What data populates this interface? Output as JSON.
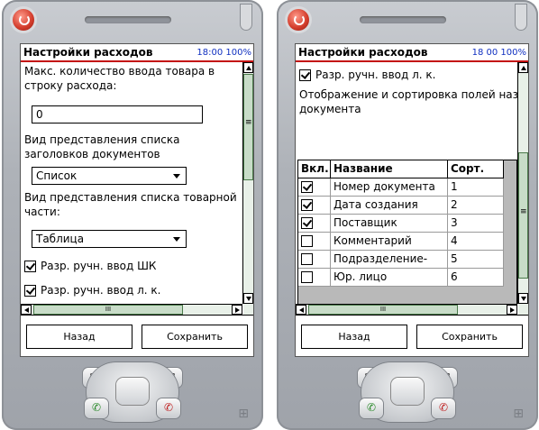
{
  "left_screen": {
    "title": "Настройки расходов",
    "time": "18:00",
    "battery": "100%",
    "max_qty_label": "Макс. количество ввода товара в строку расхода:",
    "max_qty_value": "0",
    "doc_list_view_label": "Вид представления списка заголовков документов",
    "doc_list_view_value": "Список",
    "goods_view_label": "Вид представления списка товарной части:",
    "goods_view_value": "Таблица",
    "manual_barcode_label": "Разр. ручн. ввод ШК",
    "manual_barcode_checked": true,
    "manual_account_label": "Разр. ручн. ввод л. к.",
    "manual_account_checked": true,
    "back_label": "Назад",
    "save_label": "Сохранить"
  },
  "right_screen": {
    "title": "Настройки расходов",
    "time": "18 00",
    "battery": "100%",
    "manual_account_label": "Разр. ручн. ввод л. к.",
    "manual_account_checked": true,
    "fields_label": "Отображение и сортировка полей наз документа",
    "columns": [
      "Вкл.",
      "Название",
      "Сорт."
    ],
    "rows": [
      {
        "checked": true,
        "name": "Номер документа",
        "sort": "1"
      },
      {
        "checked": true,
        "name": "Дата создания",
        "sort": "2"
      },
      {
        "checked": true,
        "name": "Поставщик",
        "sort": "3"
      },
      {
        "checked": false,
        "name": "Комментарий",
        "sort": "4"
      },
      {
        "checked": false,
        "name": "Подразделение-",
        "sort": "5"
      },
      {
        "checked": false,
        "name": "Юр. лицо",
        "sort": "6"
      }
    ],
    "back_label": "Назад",
    "save_label": "Сохранить"
  },
  "scrollbar_glyph": "III",
  "scroll_grip_glyph": "≡",
  "icons": [
    "power-icon",
    "contacts-icon",
    "calendar-icon",
    "call-icon",
    "end-call-icon",
    "windows-logo-icon"
  ],
  "colors": {
    "title_underline": "#c41010",
    "time_text": "#1030c0",
    "scroll_track": "#e8f0e8"
  }
}
